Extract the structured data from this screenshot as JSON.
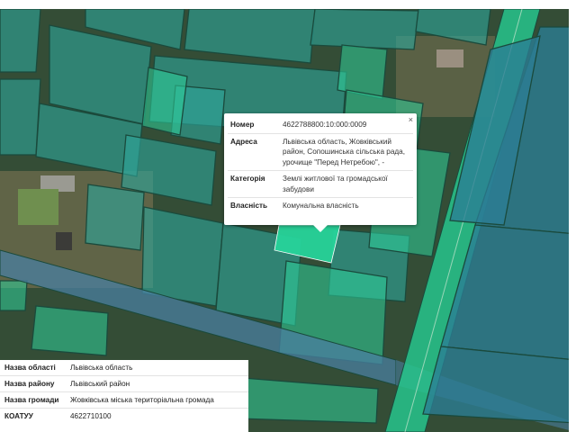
{
  "popup": {
    "close_label": "×",
    "rows": [
      {
        "key": "Номер",
        "value": "4622788800:10:000:0009"
      },
      {
        "key": "Адреса",
        "value": "Львівська область, Жовківський район, Сопошинська сільська рада, урочище \"Перед Нетребою\", -"
      },
      {
        "key": "Категорія",
        "value": "Землі житлової та громадської забудови"
      },
      {
        "key": "Власність",
        "value": "Комунальна власність"
      }
    ]
  },
  "info": {
    "rows": [
      {
        "key": "Назва області",
        "value": "Львівська область"
      },
      {
        "key": "Назва району",
        "value": "Львівський район"
      },
      {
        "key": "Назва громади",
        "value": "Жовківська міська територіальна громада"
      },
      {
        "key": "КОАТУУ",
        "value": "4622710100"
      }
    ]
  },
  "colors": {
    "parcel_fill": "#2fa59a",
    "parcel_outline": "#1a4a3c",
    "highlight_fill": "#27d39a",
    "road_fill": "#4a7fa0"
  },
  "icons": {
    "close": "close-icon"
  }
}
